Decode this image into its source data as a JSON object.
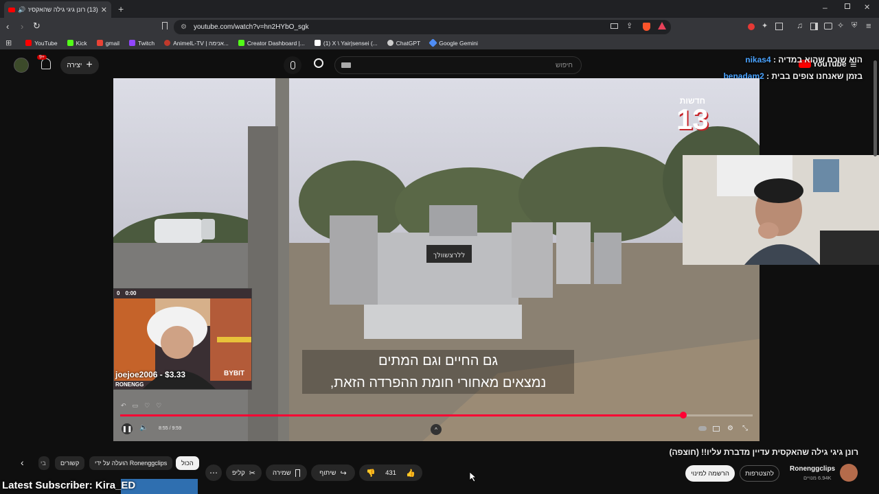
{
  "browser": {
    "tab_title": "(13) רונן גיגי גילה שהאקסית ע",
    "url": "youtube.com/watch?v=hn2HYbO_sgk",
    "bookmarks": [
      {
        "label": "YouTube",
        "color": "#ff0000"
      },
      {
        "label": "Kick",
        "color": "#53fc18"
      },
      {
        "label": "gmail",
        "color": "#ea4335"
      },
      {
        "label": "Twitch",
        "color": "#9146ff"
      },
      {
        "label": "AnimeIL-TV | אנימה...",
        "color": "#c0392b"
      },
      {
        "label": "Creator Dashboard |...",
        "color": "#53fc18"
      },
      {
        "label": "(1) X \\ Yair|sensei (...",
        "color": "#ffffff"
      },
      {
        "label": "ChatGPT",
        "color": "#cccccc"
      },
      {
        "label": "Google Gemini",
        "color": "#4f8df5"
      }
    ]
  },
  "youtube": {
    "search_placeholder": "חיפוש",
    "create_label": "יצירה",
    "notif_count": "9+",
    "logo_text": "YouTube"
  },
  "chat": [
    {
      "user": "nikas4",
      "message": "הוא שוכח שהוא במדיה :",
      "user_color": "#4aa3ff"
    },
    {
      "user": "benadam2",
      "message": "בזמן שאנחנו צופים בבית :",
      "user_color": "#4aa3ff"
    }
  ],
  "video": {
    "subtitle_line1": "גם החיים וגם המתים",
    "subtitle_line2": "נמצאים מאחורי חומת ההפרדה הזאת,",
    "channel_logo": "13",
    "channel_logo_text": "חדשות",
    "time": "8:55 / 9:59",
    "progress": 0.89,
    "gravestone_text": "ללרצשוולך"
  },
  "streamer_overlay": {
    "donation_text": "joejoe2006 - $3.33",
    "brand": "RONENGG",
    "sponsor": "BYBIT",
    "timer": "0:00",
    "counter": "0"
  },
  "below": {
    "video_title": "רונן גיגי גילה שהאקסית עדיין מדברת עליו!! (חוצפה)",
    "channel_name": "Ronenggclips",
    "subscribers": "6.94K מנויים",
    "join_label": "להצטרפות",
    "subscribe_label": "הרשמה למינוי",
    "likes": "431",
    "share_label": "שיתוף",
    "save_label": "שמירה",
    "clip_label": "קליפ",
    "chips": [
      "הכול",
      "Ronenggclips הועלה על ידי",
      "קשורים",
      "בי"
    ]
  },
  "overlay_bottom": {
    "latest_subscriber": "Latest Subscriber: Kira_ED"
  }
}
